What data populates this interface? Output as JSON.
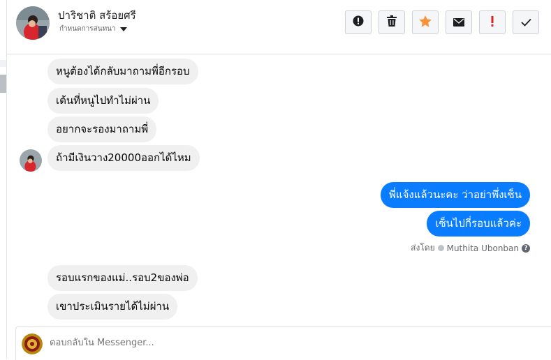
{
  "header": {
    "contact_name": "ปาริชาติ สร้อยศรี",
    "assign_label": "กำหนดการสนทนา",
    "buttons": [
      {
        "name": "report-button",
        "icon": "exclamation-circle-icon"
      },
      {
        "name": "delete-button",
        "icon": "trash-icon"
      },
      {
        "name": "star-button",
        "icon": "star-icon"
      },
      {
        "name": "mark-unread-button",
        "icon": "envelope-icon"
      },
      {
        "name": "spam-button",
        "icon": "exclamation-icon"
      },
      {
        "name": "done-button",
        "icon": "check-icon"
      }
    ]
  },
  "messages": {
    "in1": "หนูต้องได้กลับมาถามพี่อีกรอบ",
    "in2": "เต้นที่หนูไปทำไม่ผ่าน",
    "in3": "อยากจะรองมาถามพี่",
    "in4": "ถ้ามีเงินวาง20000ออกได้ไหม",
    "out1": "พี่แจ้งแล้วนะคะ ว่าอย่าพึ่งเซ็น",
    "out2": "เซ็นไปกี่รอบแล้วค่ะ",
    "sent_by_prefix": "ส่งโดย",
    "sent_by_name": "Muthita Ubonban",
    "in5": "รอบแรกของแม่..รอบ2ของพ่อ",
    "in6": "เขาประเมินรายได้ไม่ผ่าน"
  },
  "composer": {
    "placeholder": "ตอบกลับใน Messenger..."
  },
  "colors": {
    "outgoing_bubble": "#0a7cff",
    "incoming_bubble": "#f0f0f0",
    "star": "#f7923b",
    "spam": "#e02020"
  }
}
